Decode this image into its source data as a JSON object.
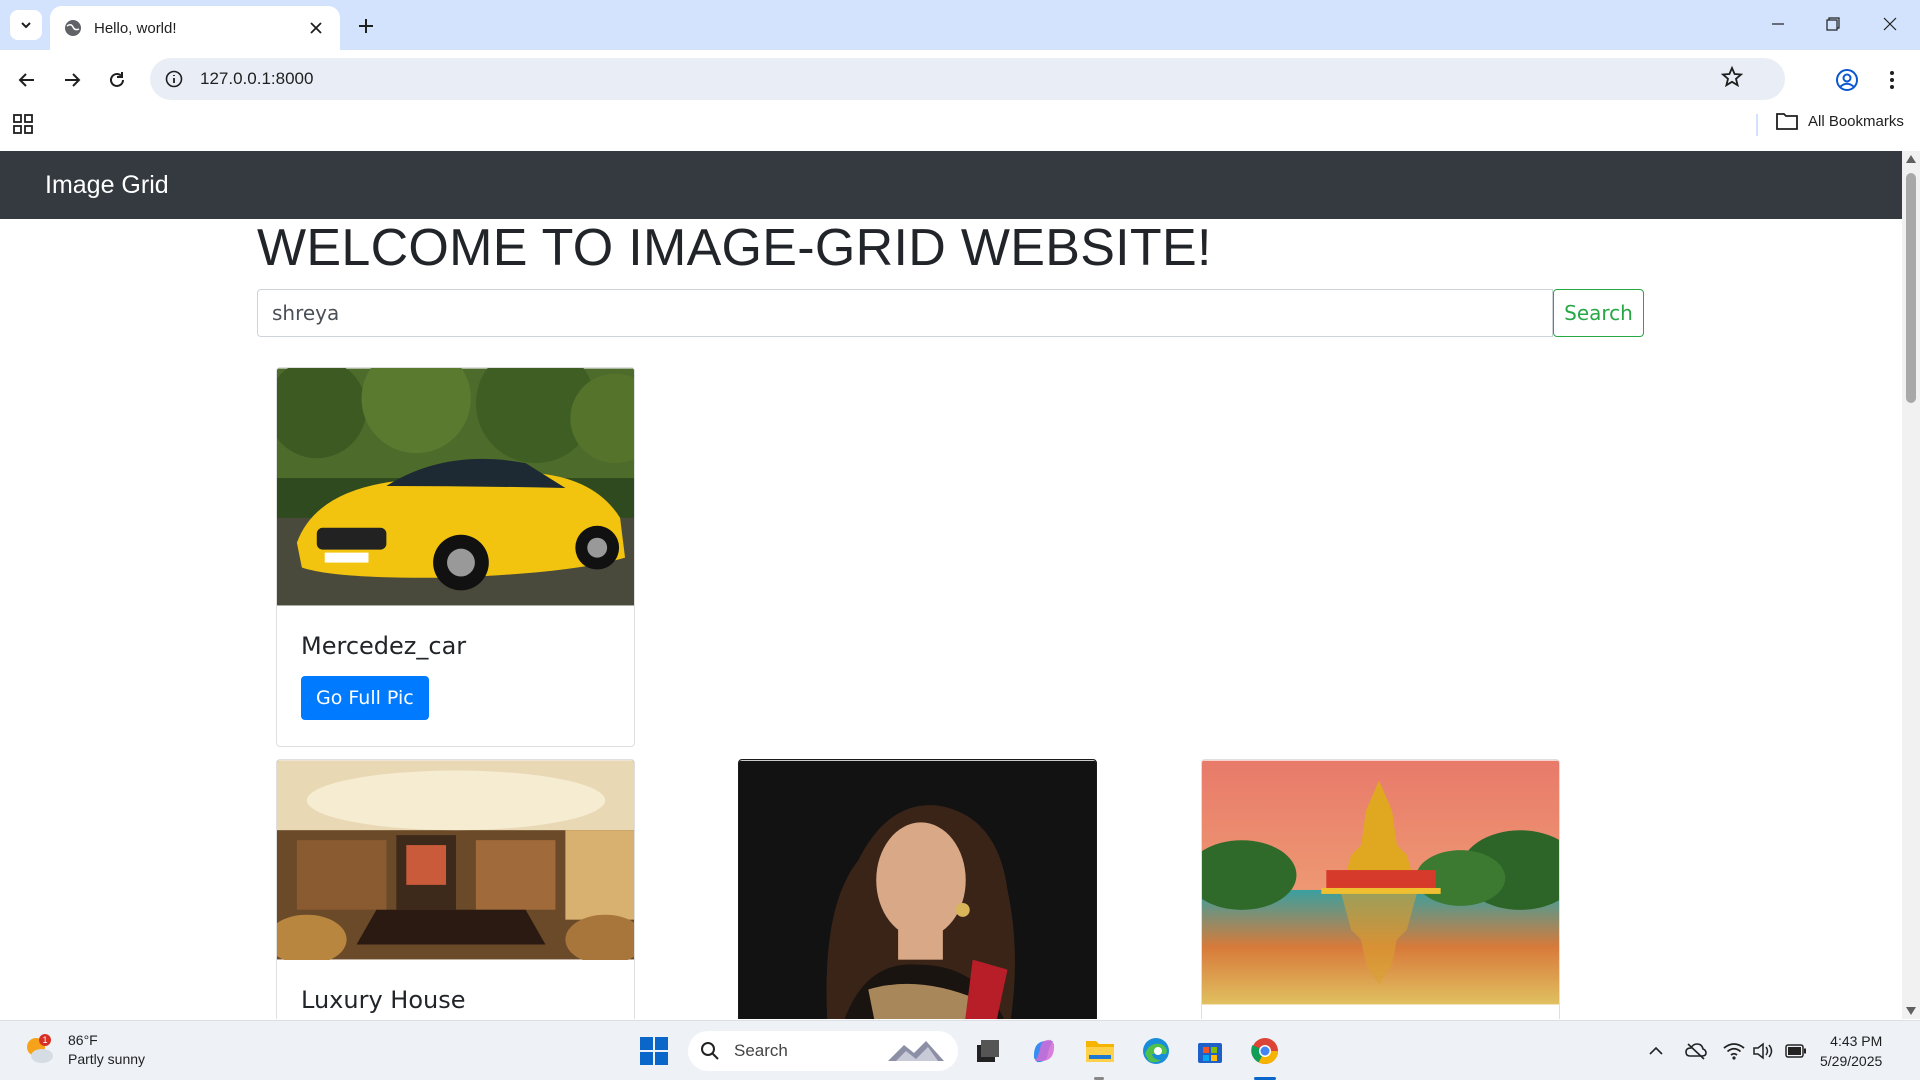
{
  "browser": {
    "tab_title": "Hello, world!",
    "url": "127.0.0.1:8000",
    "all_bookmarks_label": "All Bookmarks"
  },
  "page": {
    "brand": "Image Grid",
    "heading": "WELCOME TO IMAGE-GRID WEBSITE!",
    "search_value": "shreya",
    "search_button": "Search",
    "cards": [
      {
        "title": "Mercedez_car",
        "button": "Go Full Pic",
        "image": "yellow sports car"
      },
      {
        "title": "Luxury House",
        "button": "",
        "image": "luxury living room"
      },
      {
        "title": "",
        "button": "",
        "image": "woman portrait"
      },
      {
        "title": "",
        "button": "",
        "image": "temple by lake"
      }
    ]
  },
  "taskbar": {
    "temperature": "86°F",
    "condition": "Partly sunny",
    "weather_badge": "1",
    "search_placeholder": "Search",
    "time": "4:43 PM",
    "date": "5/29/2025"
  },
  "colors": {
    "navbar": "#343a40",
    "primary_button": "#007bff",
    "success_outline": "#28a745",
    "tabbar": "#d3e3fd"
  }
}
